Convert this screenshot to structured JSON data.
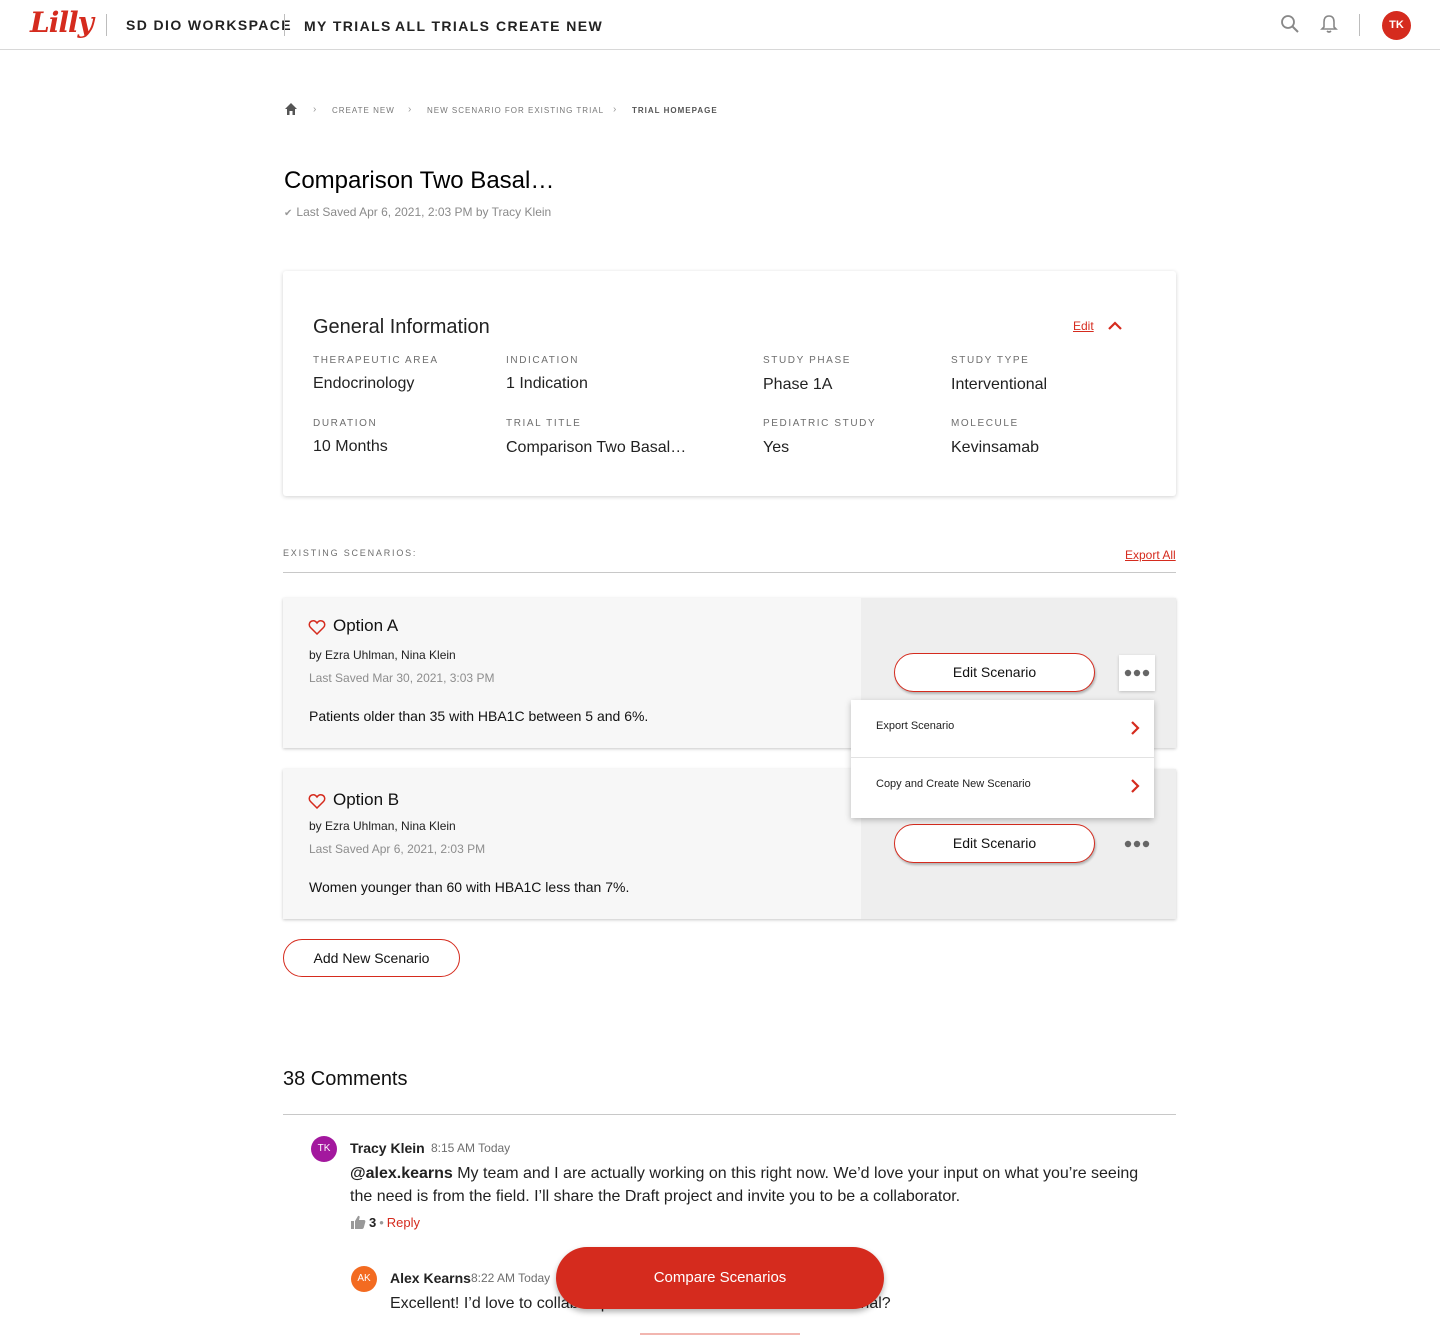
{
  "topnav": {
    "logo_text": "Lilly",
    "workspace": "SD DIO WORKSPACE",
    "links": [
      "MY TRIALS",
      "ALL TRIALS",
      "CREATE NEW"
    ],
    "user_initials": "TK",
    "icons": [
      "search-icon",
      "bell-icon"
    ],
    "accent_color": "#d52b1e"
  },
  "breadcrumb": {
    "items": [
      "CREATE NEW",
      "NEW SCENARIO FOR EXISTING TRIAL",
      "TRIAL HOMEPAGE"
    ],
    "separator": "›"
  },
  "page": {
    "title": "Comparison Two Basal…",
    "saved": "Last Saved Apr 6, 2021, 2:03 PM by Tracy Klein"
  },
  "general_info": {
    "title": "General Information",
    "edit_label": "Edit",
    "fields": [
      {
        "label": "THERAPEUTIC AREA",
        "value": "Endocrinology"
      },
      {
        "label": "INDICATION",
        "value": "1 Indication"
      },
      {
        "label": "STUDY PHASE",
        "value": "Phase 1A"
      },
      {
        "label": "STUDY TYPE",
        "value": "Interventional"
      },
      {
        "label": "DURATION",
        "value": "10 Months"
      },
      {
        "label": "TRIAL TITLE",
        "value": "Comparison Two Basal…"
      },
      {
        "label": "PEDIATRIC STUDY",
        "value": "Yes"
      },
      {
        "label": "MOLECULE",
        "value": "Kevinsamab"
      }
    ]
  },
  "scenarios": {
    "section_label": "EXISTING SCENARIOS:",
    "export_all": "Export All",
    "items": [
      {
        "title": "Option A",
        "by": "by Ezra Uhlman, Nina Klein",
        "saved": "Last Saved Mar 30, 2021, 3:03 PM",
        "description": "Patients older than 35 with HBA1C between 5 and 6%.",
        "edit_label": "Edit Scenario"
      },
      {
        "title": "Option B",
        "by": "by Ezra Uhlman, Nina Klein",
        "saved": "Last Saved Apr 6, 2021, 2:03 PM",
        "description": "Women younger than 60 with HBA1C less than 7%.",
        "edit_label": "Edit Scenario"
      }
    ],
    "menu": [
      "Export Scenario",
      "Copy and Create New Scenario"
    ],
    "add_label": "Add New Scenario"
  },
  "comments": {
    "title": "38 Comments",
    "items": [
      {
        "initials": "TK",
        "avatar_color": "#a3189e",
        "name": "Tracy Klein",
        "time": "8:15 AM Today",
        "mention": "@alex.kearns",
        "text": " My team and I are actually working on this right now. We’d love your input on what you’re seeing the need is from the field. I’ll share the Draft project and invite you to be a collaborator.",
        "likes": "3",
        "reply": "Reply"
      },
      {
        "initials": "AK",
        "avatar_color": "#f36b21",
        "name": "Alex Kearns",
        "time": "8:22 AM Today",
        "text": "Excellent! I’d love to collab departments are interested in this material?"
      }
    ]
  },
  "compare_label": "Compare Scenarios"
}
